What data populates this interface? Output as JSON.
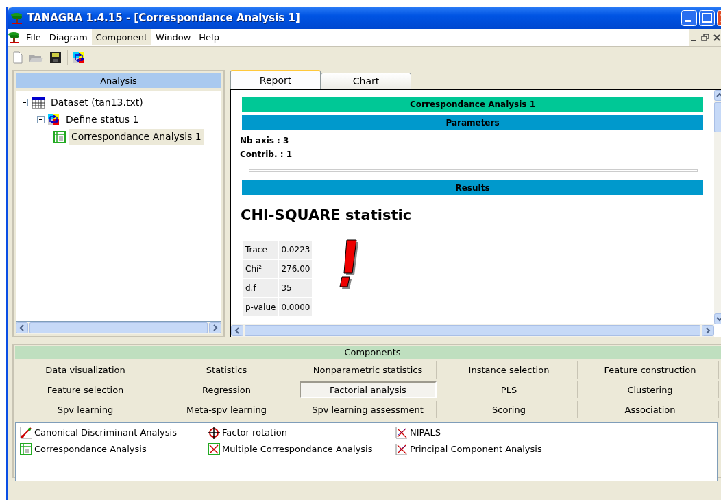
{
  "window": {
    "title": "TANAGRA 1.4.15 - [Correspondance Analysis 1]"
  },
  "menu": [
    {
      "label": "File",
      "selected": false
    },
    {
      "label": "Diagram",
      "selected": false
    },
    {
      "label": "Component",
      "selected": true
    },
    {
      "label": "Window",
      "selected": false
    },
    {
      "label": "Help",
      "selected": false
    }
  ],
  "analysis": {
    "title": "Analysis",
    "tree": [
      {
        "label": "Dataset (tan13.txt)",
        "kind": "dataset",
        "expanded": true,
        "selected": false,
        "children": [
          {
            "label": "Define status 1",
            "kind": "status",
            "expanded": true,
            "selected": false,
            "children": [
              {
                "label": "Correspondance Analysis 1",
                "kind": "correspondance",
                "selected": true
              }
            ]
          }
        ]
      }
    ]
  },
  "tabs": [
    {
      "label": "Report",
      "selected": true
    },
    {
      "label": "Chart",
      "selected": false
    }
  ],
  "report": {
    "title": "Correspondance Analysis 1",
    "parameters_header": "Parameters",
    "parameters": [
      "Nb axis : 3",
      "Contrib. : 1"
    ],
    "results_header": "Results",
    "heading": "CHI-SQUARE statistic",
    "stats": [
      {
        "label": "Trace",
        "value": "0.0223"
      },
      {
        "label": "Chi²",
        "value": "276.00"
      },
      {
        "label": "d.f",
        "value": "35"
      },
      {
        "label": "p-value",
        "value": "0.0000"
      }
    ]
  },
  "components": {
    "title": "Components",
    "tabs": [
      {
        "label": "Data visualization",
        "selected": false
      },
      {
        "label": "Statistics",
        "selected": false
      },
      {
        "label": "Nonparametric statistics",
        "selected": false
      },
      {
        "label": "Instance selection",
        "selected": false
      },
      {
        "label": "Feature construction",
        "selected": false
      },
      {
        "label": "Feature selection",
        "selected": false
      },
      {
        "label": "Regression",
        "selected": false
      },
      {
        "label": "Factorial analysis",
        "selected": true
      },
      {
        "label": "PLS",
        "selected": false
      },
      {
        "label": "Clustering",
        "selected": false
      },
      {
        "label": "Spv learning",
        "selected": false
      },
      {
        "label": "Meta-spv learning",
        "selected": false
      },
      {
        "label": "Spv learning assessment",
        "selected": false
      },
      {
        "label": "Scoring",
        "selected": false
      },
      {
        "label": "Association",
        "selected": false
      }
    ],
    "items": [
      {
        "label": "Canonical Discriminant Analysis",
        "kind": "canonical"
      },
      {
        "label": "Correspondance Analysis",
        "kind": "correspondance"
      },
      {
        "label": "Factor rotation",
        "kind": "rotation"
      },
      {
        "label": "Multiple Correspondance Analysis",
        "kind": "multiple"
      },
      {
        "label": "NIPALS",
        "kind": "scatter"
      },
      {
        "label": "Principal Component Analysis",
        "kind": "scatter"
      }
    ]
  }
}
